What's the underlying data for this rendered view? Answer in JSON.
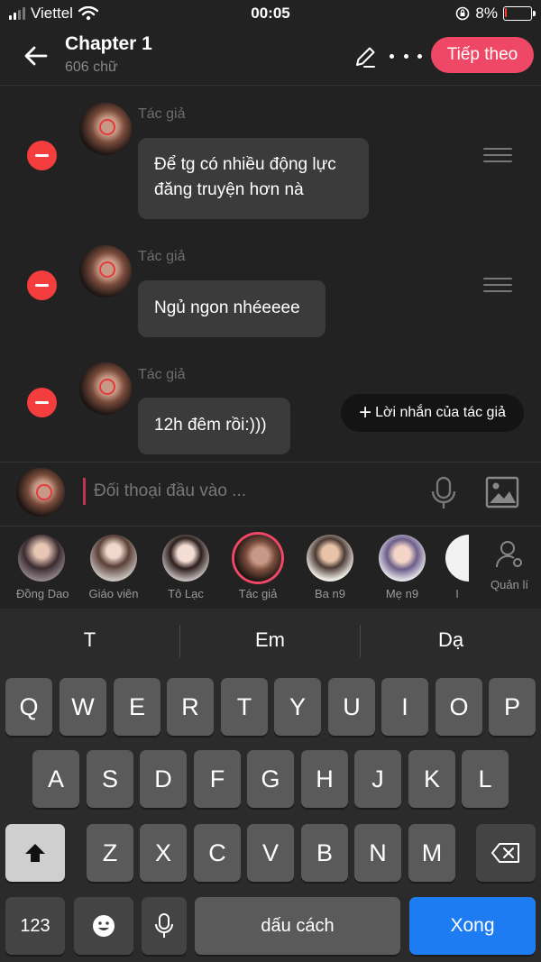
{
  "status_bar": {
    "carrier": "Viettel",
    "time": "00:05",
    "battery": "8%",
    "battery_level": 0.08
  },
  "header": {
    "title": "Chapter 1",
    "word_count": "606 chữ",
    "next_button": "Tiếp theo"
  },
  "messages": [
    {
      "author": "Tác giả",
      "line1": "Để tg có nhiều động lực",
      "line2": "đăng truyện hơn nà"
    },
    {
      "author": "Tác giả",
      "line1": "Ngủ ngon nhéeeee",
      "line2": ""
    },
    {
      "author": "Tác giả",
      "line1": "12h đêm rồi:)))",
      "line2": ""
    }
  ],
  "author_note_button": "Lời nhắn của tác giả",
  "input": {
    "placeholder": "Đối thoại đầu vào ..."
  },
  "characters": [
    {
      "name": "Đồng Dao",
      "selected": false
    },
    {
      "name": "Giáo viên",
      "selected": false
    },
    {
      "name": "Tô Lạc",
      "selected": false
    },
    {
      "name": "Tác giả",
      "selected": true
    },
    {
      "name": "Ba n9",
      "selected": false
    },
    {
      "name": "Mẹ n9",
      "selected": false
    },
    {
      "name": "I",
      "selected": false
    }
  ],
  "manage_label": "Quản lí",
  "keyboard": {
    "suggestions": [
      "T",
      "Em",
      "Dạ"
    ],
    "row1": [
      "Q",
      "W",
      "E",
      "R",
      "T",
      "Y",
      "U",
      "I",
      "O",
      "P"
    ],
    "row2": [
      "A",
      "S",
      "D",
      "F",
      "G",
      "H",
      "J",
      "K",
      "L"
    ],
    "row3": [
      "Z",
      "X",
      "C",
      "V",
      "B",
      "N",
      "M"
    ],
    "numbers_key": "123",
    "space_key": "dấu cách",
    "done_key": "Xong"
  },
  "colors": {
    "accent": "#ef4766",
    "remove": "#f43d3d",
    "done_key": "#1e7cf2",
    "background": "#222222"
  }
}
